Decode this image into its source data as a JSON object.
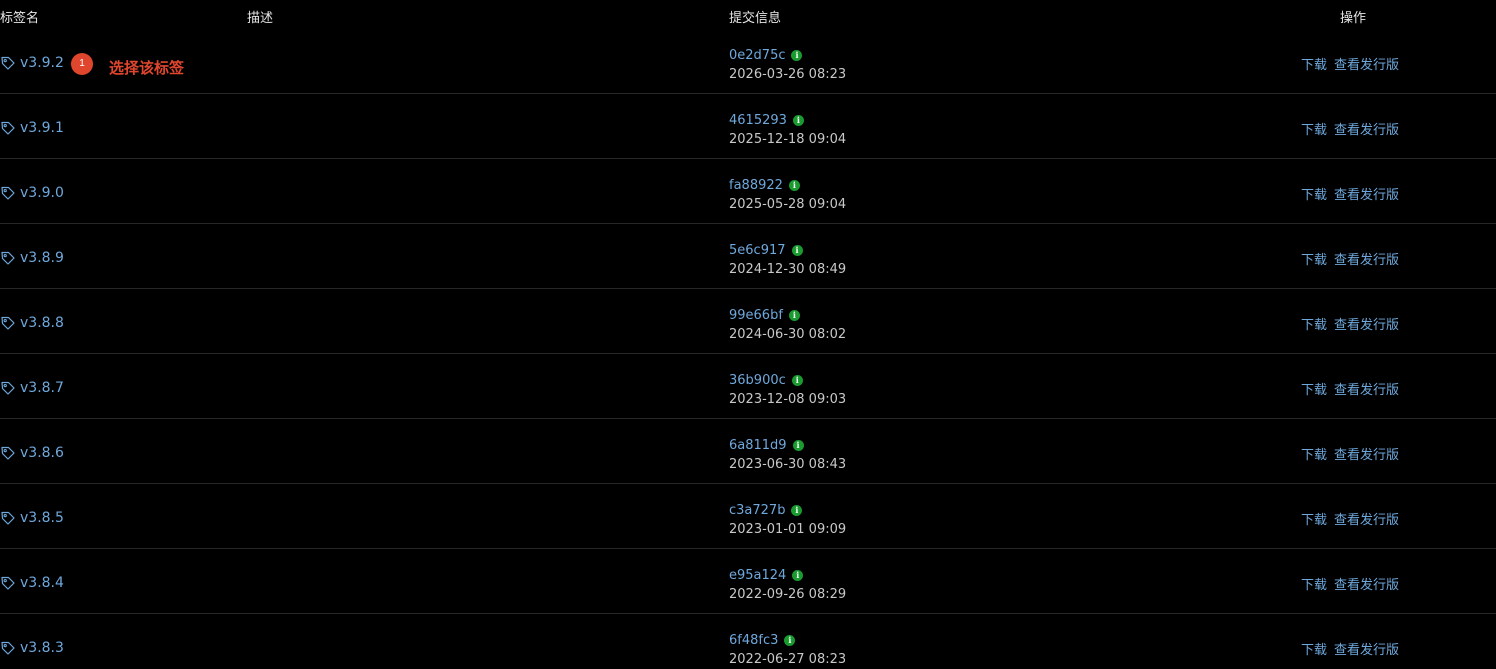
{
  "headers": {
    "tag_name": "标签名",
    "description": "描述",
    "commit_info": "提交信息",
    "actions": "操作"
  },
  "annotation": {
    "badge": "1",
    "text": "选择该标签"
  },
  "rows": [
    {
      "tag": "v3.9.2",
      "hash": "0e2d75c",
      "date": "2026-03-26 08:23",
      "download": "下载",
      "view_release": "查看发行版"
    },
    {
      "tag": "v3.9.1",
      "hash": "4615293",
      "date": "2025-12-18 09:04",
      "download": "下载",
      "view_release": "查看发行版"
    },
    {
      "tag": "v3.9.0",
      "hash": "fa88922",
      "date": "2025-05-28 09:04",
      "download": "下载",
      "view_release": "查看发行版"
    },
    {
      "tag": "v3.8.9",
      "hash": "5e6c917",
      "date": "2024-12-30 08:49",
      "download": "下载",
      "view_release": "查看发行版"
    },
    {
      "tag": "v3.8.8",
      "hash": "99e66bf",
      "date": "2024-06-30 08:02",
      "download": "下载",
      "view_release": "查看发行版"
    },
    {
      "tag": "v3.8.7",
      "hash": "36b900c",
      "date": "2023-12-08 09:03",
      "download": "下载",
      "view_release": "查看发行版"
    },
    {
      "tag": "v3.8.6",
      "hash": "6a811d9",
      "date": "2023-06-30 08:43",
      "download": "下载",
      "view_release": "查看发行版"
    },
    {
      "tag": "v3.8.5",
      "hash": "c3a727b",
      "date": "2023-01-01 09:09",
      "download": "下载",
      "view_release": "查看发行版"
    },
    {
      "tag": "v3.8.4",
      "hash": "e95a124",
      "date": "2022-09-26 08:29",
      "download": "下载",
      "view_release": "查看发行版"
    },
    {
      "tag": "v3.8.3",
      "hash": "6f48fc3",
      "date": "2022-06-27 08:23",
      "download": "下载",
      "view_release": "查看发行版"
    }
  ],
  "colors": {
    "background": "#000000",
    "link": "#6fa8dc",
    "annotation": "#e0462d",
    "verified": "#1a9b2f"
  },
  "icons": {
    "tag": "tag-icon",
    "info": "info-icon"
  }
}
